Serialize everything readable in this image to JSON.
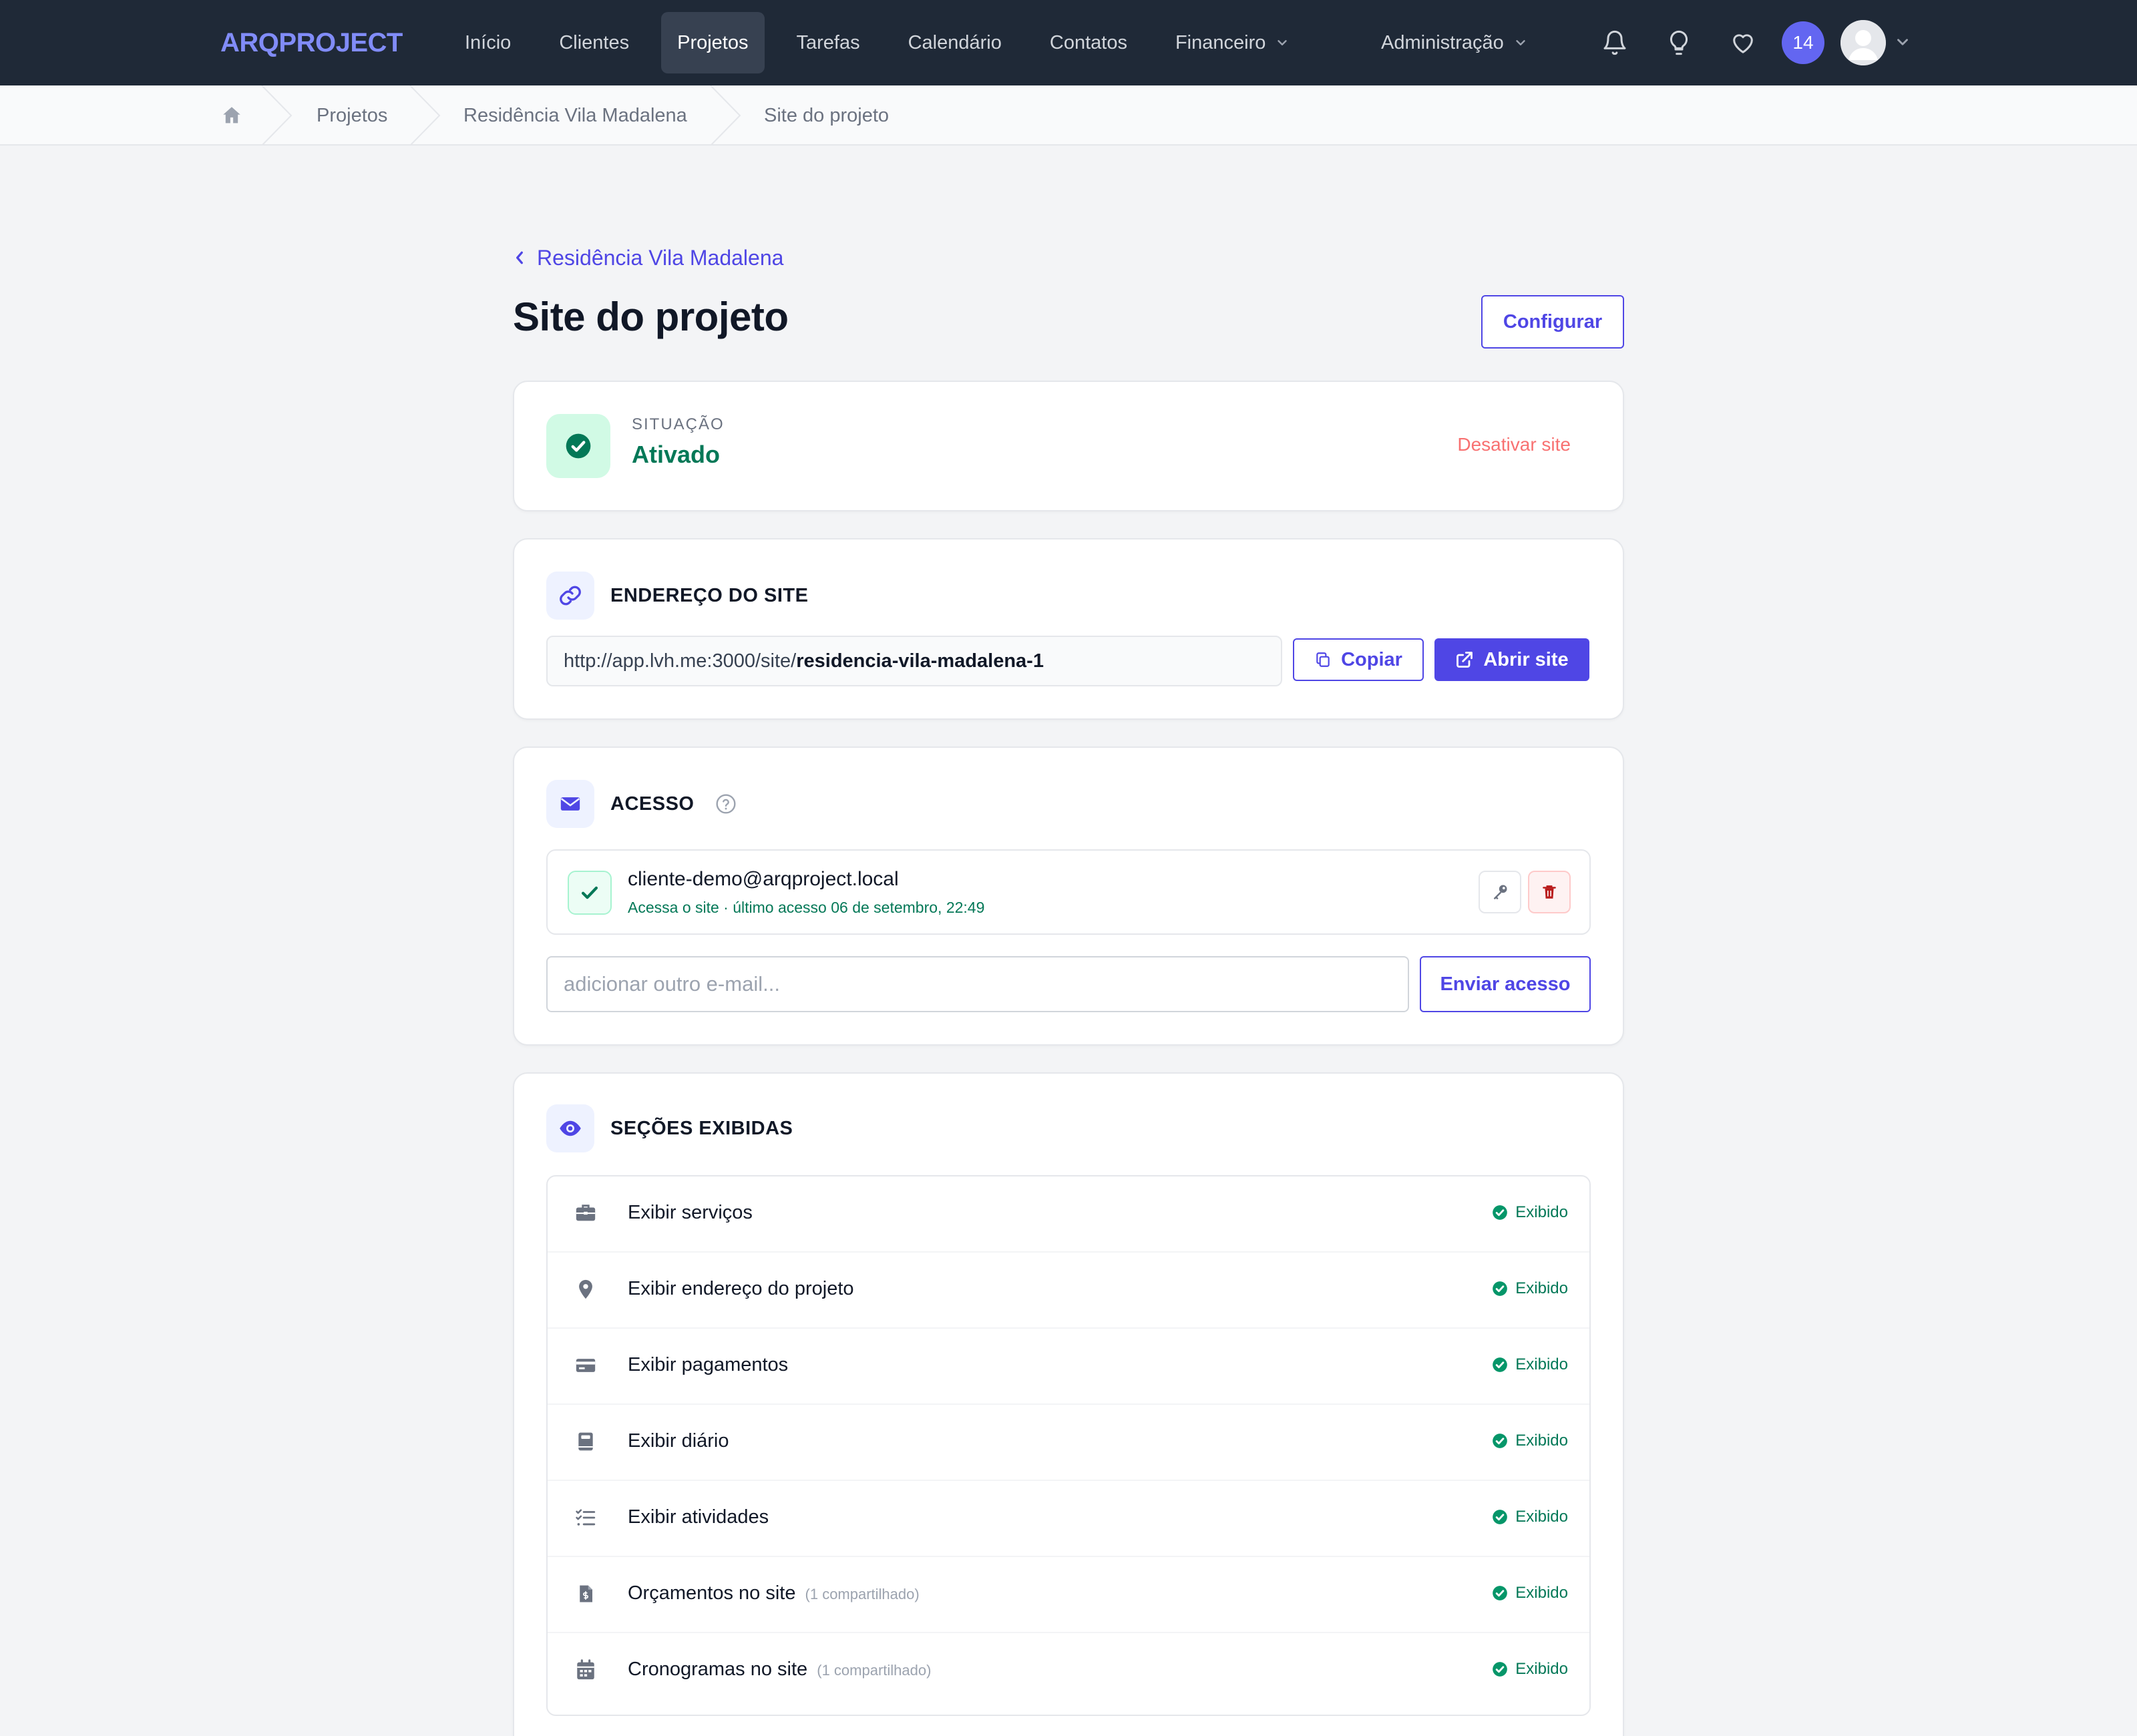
{
  "app": {
    "logo": "ARQPROJECT",
    "nav": [
      "Início",
      "Clientes",
      "Projetos",
      "Tarefas",
      "Calendário",
      "Contatos",
      "Financeiro"
    ],
    "nav_active": "Projetos",
    "admin_label": "Administração",
    "notification_count": "14",
    "accent_color": "#4f46e5"
  },
  "breadcrumb": [
    "Projetos",
    "Residência Vila Madalena",
    "Site do projeto"
  ],
  "page": {
    "back_label": "Residência Vila Madalena",
    "title": "Site do projeto",
    "configure_label": "Configurar"
  },
  "status": {
    "label": "SITUAÇÃO",
    "value": "Ativado",
    "deactivate_label": "Desativar site"
  },
  "url_section": {
    "title": "ENDEREÇO DO SITE",
    "url_prefix": "http://app.lvh.me:3000/site/",
    "url_slug": "residencia-vila-madalena-1",
    "copy_label": "Copiar",
    "open_label": "Abrir site"
  },
  "access": {
    "title": "ACESSO",
    "email": "cliente-demo@arqproject.local",
    "meta": "Acessa o site · último acesso 06 de setembro, 22:49",
    "input_placeholder": "adicionar outro e-mail...",
    "send_label": "Enviar acesso"
  },
  "sections": {
    "title": "SEÇÕES EXIBIDAS",
    "status_label": "Exibido",
    "items": [
      {
        "label": "Exibir serviços",
        "note": "",
        "icon": "briefcase-icon"
      },
      {
        "label": "Exibir endereço do projeto",
        "note": "",
        "icon": "map-pin-icon"
      },
      {
        "label": "Exibir pagamentos",
        "note": "",
        "icon": "credit-card-icon"
      },
      {
        "label": "Exibir diário",
        "note": "",
        "icon": "book-icon"
      },
      {
        "label": "Exibir atividades",
        "note": "",
        "icon": "checklist-icon"
      },
      {
        "label": "Orçamentos no site",
        "note": "(1 compartilhado)",
        "icon": "invoice-icon"
      },
      {
        "label": "Cronogramas no site",
        "note": "(1 compartilhado)",
        "icon": "calendar-icon"
      }
    ]
  }
}
